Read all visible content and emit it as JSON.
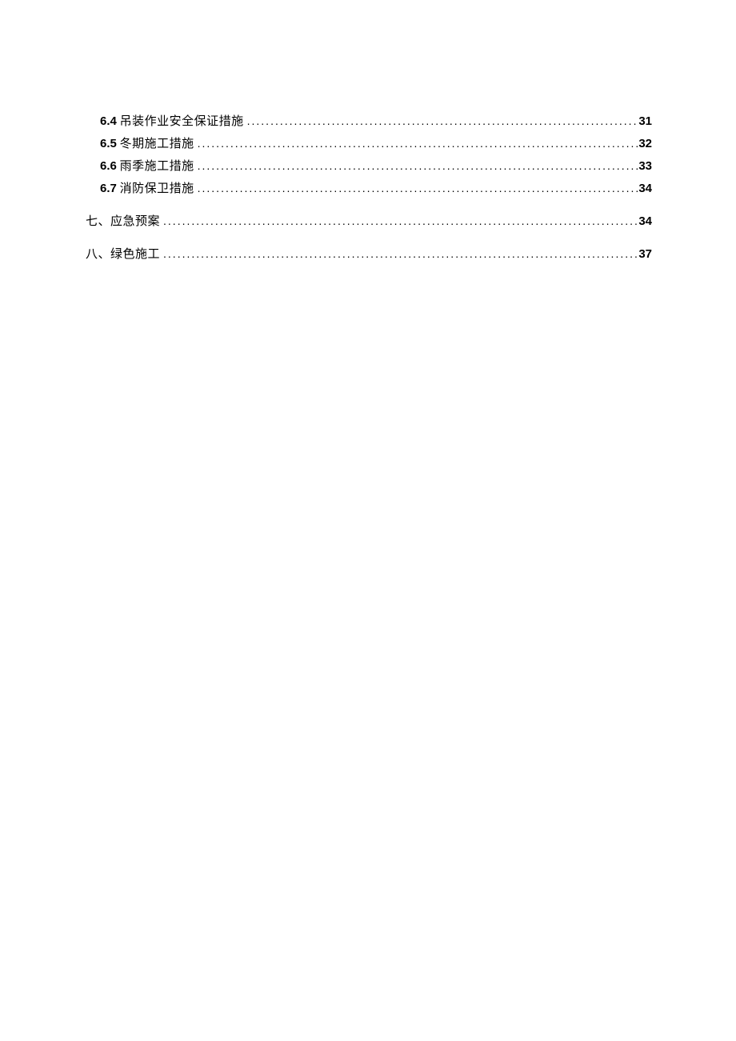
{
  "toc": [
    {
      "level": 2,
      "number": "6.4",
      "title_prefix": "  ",
      "title": "吊装作业安全保证措施",
      "page": "31"
    },
    {
      "level": 2,
      "number": "6.5",
      "title_prefix": " ",
      "title": "冬期施工措施",
      "page": "32"
    },
    {
      "level": 2,
      "number": "6.6",
      "title_prefix": " ",
      "title": "雨季施工措施",
      "page": "33"
    },
    {
      "level": 2,
      "number": "6.7",
      "title_prefix": " ",
      "title": "消防保卫措施",
      "page": "34"
    },
    {
      "level": 1,
      "number": "七、",
      "title_prefix": "",
      "title": "应急预案",
      "page": "34"
    },
    {
      "level": 1,
      "number": "八、",
      "title_prefix": "",
      "title": "绿色施工",
      "page": "37"
    }
  ]
}
